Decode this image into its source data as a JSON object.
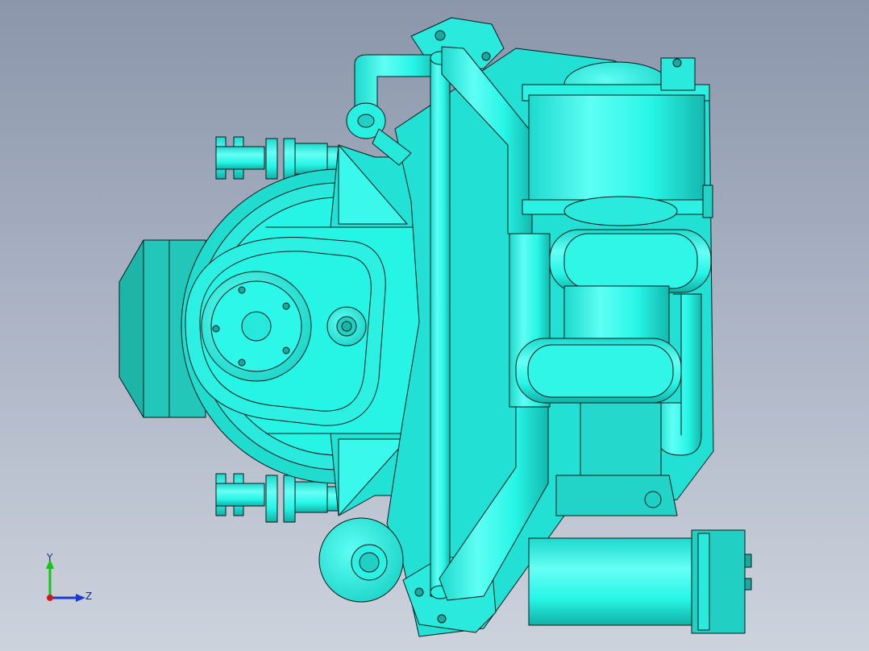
{
  "viewport": {
    "background_top": "#8b96ab",
    "background_bottom": "#cdd3dd"
  },
  "model": {
    "fill_color": "#26f5e6",
    "shade_color": "#17c9bd",
    "edge_color": "#0a1a1a"
  },
  "triad": {
    "y_label": "Y",
    "z_label": "Z",
    "y_color": "#16c41a",
    "z_color": "#1a3ad0",
    "origin_color": "#d01818"
  }
}
